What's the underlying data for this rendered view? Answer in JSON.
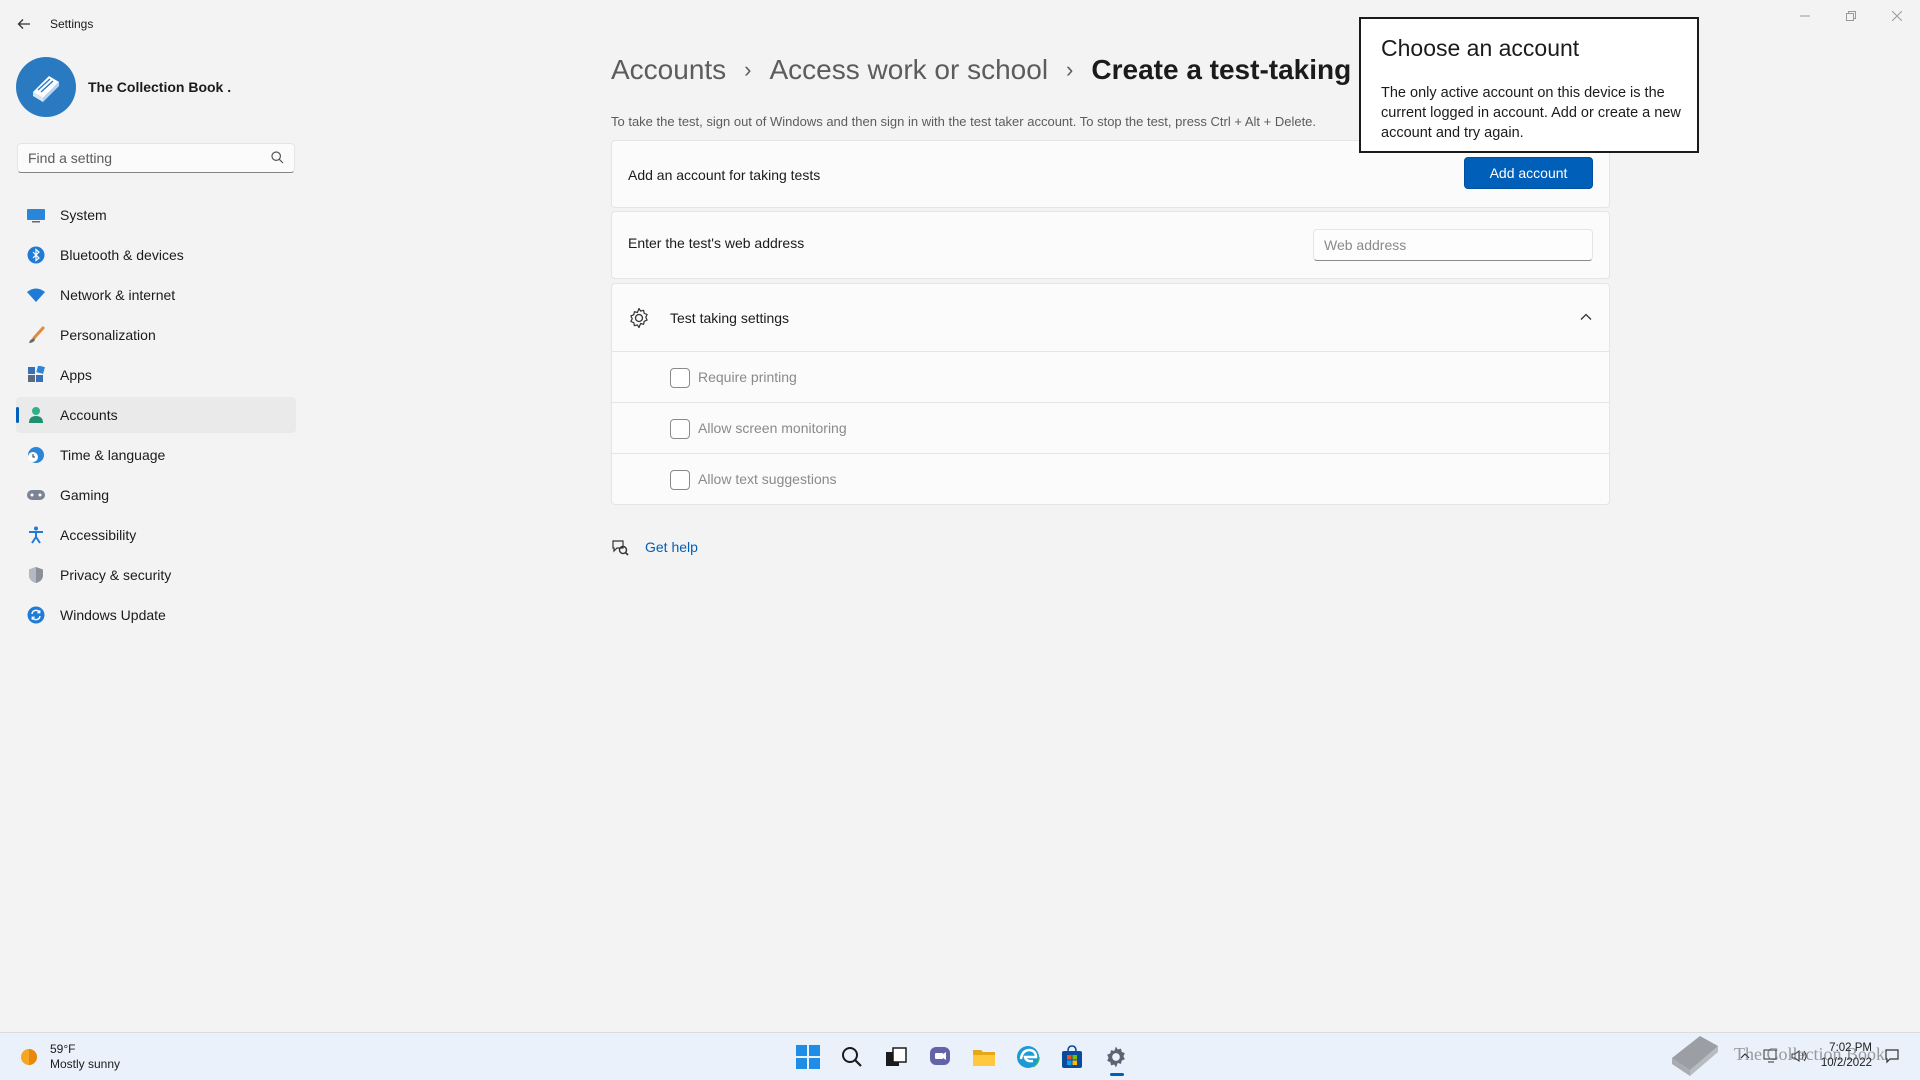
{
  "window": {
    "app_title": "Settings",
    "controls": [
      "minimize",
      "restore",
      "close"
    ]
  },
  "profile": {
    "name": "The Collection Book ."
  },
  "search": {
    "placeholder": "Find a setting"
  },
  "sidebar": {
    "items": [
      {
        "label": "System",
        "icon": "system-icon"
      },
      {
        "label": "Bluetooth & devices",
        "icon": "bluetooth-icon"
      },
      {
        "label": "Network & internet",
        "icon": "wifi-icon"
      },
      {
        "label": "Personalization",
        "icon": "brush-icon"
      },
      {
        "label": "Apps",
        "icon": "apps-icon"
      },
      {
        "label": "Accounts",
        "icon": "person-icon",
        "active": true
      },
      {
        "label": "Time & language",
        "icon": "globe-clock-icon"
      },
      {
        "label": "Gaming",
        "icon": "gamepad-icon"
      },
      {
        "label": "Accessibility",
        "icon": "accessibility-icon"
      },
      {
        "label": "Privacy & security",
        "icon": "shield-icon"
      },
      {
        "label": "Windows Update",
        "icon": "update-icon"
      }
    ]
  },
  "breadcrumb": {
    "items": [
      "Accounts",
      "Access work or school",
      "Create a test-taking a"
    ],
    "separator": "›"
  },
  "description": "To take the test, sign out of Windows and then sign in with the test taker account. To stop the test, press Ctrl + Alt + Delete.",
  "cards": {
    "add_account": {
      "label": "Add an account for taking tests",
      "button": "Add account"
    },
    "web_address": {
      "label": "Enter the test's web address",
      "placeholder": "Web address"
    },
    "test_settings": {
      "title": "Test taking settings",
      "options": [
        {
          "label": "Require printing",
          "checked": false
        },
        {
          "label": "Allow screen monitoring",
          "checked": false
        },
        {
          "label": "Allow text suggestions",
          "checked": false
        }
      ]
    }
  },
  "help": {
    "label": "Get help"
  },
  "popup": {
    "title": "Choose an account",
    "body": "The only active account on this device is the current logged in account. Add or create a new account and try again."
  },
  "taskbar": {
    "weather": {
      "temp": "59°F",
      "condition": "Mostly sunny"
    },
    "apps": [
      "start-icon",
      "search-icon",
      "task-view-icon",
      "teams-chat-icon",
      "file-explorer-icon",
      "edge-icon",
      "store-icon",
      "settings-icon"
    ],
    "clock": {
      "time": "7:02 PM",
      "date": "10/2/2022"
    },
    "watermark": "The Collection Book"
  },
  "colors": {
    "accent": "#005fb8",
    "background": "#f3f3f3",
    "card": "#fbfbfb"
  }
}
